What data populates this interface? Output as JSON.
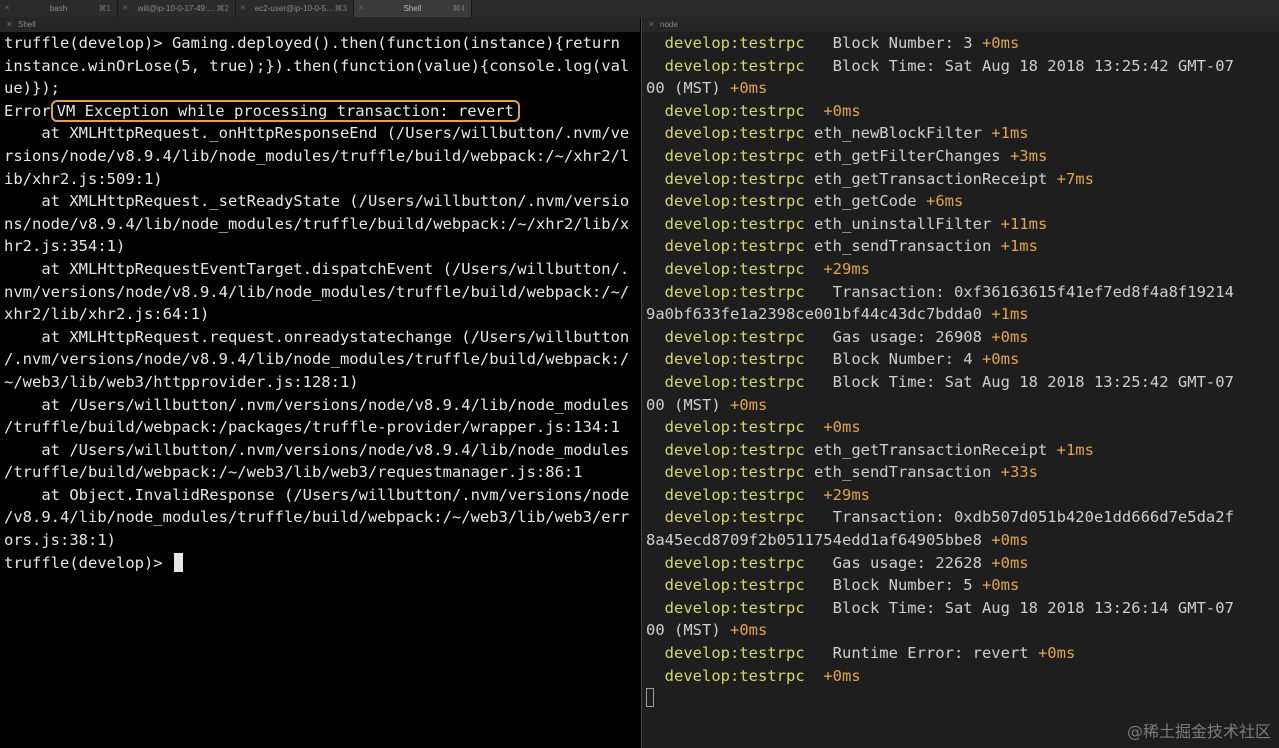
{
  "tabs": [
    {
      "title": "bash",
      "shortcut": "⌘1"
    },
    {
      "title": "will@ip-10-0-17-49:…",
      "shortcut": "⌘2"
    },
    {
      "title": "ec2-user@ip-10-0-5…",
      "shortcut": "⌘3"
    },
    {
      "title": "Shell",
      "shortcut": "⌘4"
    }
  ],
  "left_pane": {
    "title": "Shell",
    "lines": [
      "truffle(develop)> Gaming.deployed().then(function(instance){return",
      "instance.winOrLose(5, true);}).then(function(value){console.log(val",
      "ue)});",
      "",
      "    at XMLHttpRequest._onHttpResponseEnd (/Users/willbutton/.nvm/ve",
      "rsions/node/v8.9.4/lib/node_modules/truffle/build/webpack:/~/xhr2/l",
      "ib/xhr2.js:509:1)",
      "    at XMLHttpRequest._setReadyState (/Users/willbutton/.nvm/versio",
      "ns/node/v8.9.4/lib/node_modules/truffle/build/webpack:/~/xhr2/lib/x",
      "hr2.js:354:1)",
      "    at XMLHttpRequestEventTarget.dispatchEvent (/Users/willbutton/.",
      "nvm/versions/node/v8.9.4/lib/node_modules/truffle/build/webpack:/~/",
      "xhr2/lib/xhr2.js:64:1)",
      "    at XMLHttpRequest.request.onreadystatechange (/Users/willbutton",
      "/.nvm/versions/node/v8.9.4/lib/node_modules/truffle/build/webpack:/",
      "~/web3/lib/web3/httpprovider.js:128:1)",
      "    at /Users/willbutton/.nvm/versions/node/v8.9.4/lib/node_modules",
      "/truffle/build/webpack:/packages/truffle-provider/wrapper.js:134:1",
      "    at /Users/willbutton/.nvm/versions/node/v8.9.4/lib/node_modules",
      "/truffle/build/webpack:/~/web3/lib/web3/requestmanager.js:86:1",
      "    at Object.InvalidResponse (/Users/willbutton/.nvm/versions/node",
      "/v8.9.4/lib/node_modules/truffle/build/webpack:/~/web3/lib/web3/err",
      "ors.js:38:1)"
    ],
    "error_prefix": "Error",
    "error_message": "VM Exception while processing transaction: revert",
    "prompt": "truffle(develop)> "
  },
  "right_pane": {
    "title": "node",
    "lines": [
      {
        "g": "develop:testrpc",
        "m": "   Block Number: 3 ",
        "t": "+0ms"
      },
      {
        "g": "develop:testrpc",
        "m": "   Block Time: Sat Aug 18 2018 13:25:42 GMT-07",
        "t": ""
      },
      {
        "g": "",
        "m": "00 (MST) ",
        "t": "+0ms",
        "wrap": true
      },
      {
        "g": "develop:testrpc",
        "m": "  ",
        "t": "+0ms"
      },
      {
        "g": "develop:testrpc",
        "m": " eth_newBlockFilter ",
        "t": "+1ms"
      },
      {
        "g": "develop:testrpc",
        "m": " eth_getFilterChanges ",
        "t": "+3ms"
      },
      {
        "g": "develop:testrpc",
        "m": " eth_getTransactionReceipt ",
        "t": "+7ms"
      },
      {
        "g": "develop:testrpc",
        "m": " eth_getCode ",
        "t": "+6ms"
      },
      {
        "g": "develop:testrpc",
        "m": " eth_uninstallFilter ",
        "t": "+11ms"
      },
      {
        "g": "develop:testrpc",
        "m": " eth_sendTransaction ",
        "t": "+1ms"
      },
      {
        "g": "develop:testrpc",
        "m": "  ",
        "t": "+29ms"
      },
      {
        "g": "develop:testrpc",
        "m": "   Transaction: 0xf36163615f41ef7ed8f4a8f19214",
        "t": ""
      },
      {
        "g": "",
        "m": "9a0bf633fe1a2398ce001bf44c43dc7bdda0 ",
        "t": "+1ms",
        "wrap": true
      },
      {
        "g": "develop:testrpc",
        "m": "   Gas usage: 26908 ",
        "t": "+0ms"
      },
      {
        "g": "develop:testrpc",
        "m": "   Block Number: 4 ",
        "t": "+0ms"
      },
      {
        "g": "develop:testrpc",
        "m": "   Block Time: Sat Aug 18 2018 13:25:42 GMT-07",
        "t": ""
      },
      {
        "g": "",
        "m": "00 (MST) ",
        "t": "+0ms",
        "wrap": true
      },
      {
        "g": "develop:testrpc",
        "m": "  ",
        "t": "+0ms"
      },
      {
        "g": "develop:testrpc",
        "m": " eth_getTransactionReceipt ",
        "t": "+1ms"
      },
      {
        "g": "develop:testrpc",
        "m": " eth_sendTransaction ",
        "t": "+33s"
      },
      {
        "g": "develop:testrpc",
        "m": "  ",
        "t": "+29ms"
      },
      {
        "g": "develop:testrpc",
        "m": "   Transaction: 0xdb507d051b420e1dd666d7e5da2f",
        "t": ""
      },
      {
        "g": "",
        "m": "8a45ecd8709f2b0511754edd1af64905bbe8 ",
        "t": "+0ms",
        "wrap": true
      },
      {
        "g": "develop:testrpc",
        "m": "   Gas usage: 22628 ",
        "t": "+0ms"
      },
      {
        "g": "develop:testrpc",
        "m": "   Block Number: 5 ",
        "t": "+0ms"
      },
      {
        "g": "develop:testrpc",
        "m": "   Block Time: Sat Aug 18 2018 13:26:14 GMT-07",
        "t": ""
      },
      {
        "g": "",
        "m": "00 (MST) ",
        "t": "+0ms",
        "wrap": true
      },
      {
        "g": "develop:testrpc",
        "m": "   Runtime Error: revert ",
        "t": "+0ms"
      },
      {
        "g": "develop:testrpc",
        "m": "  ",
        "t": "+0ms"
      }
    ]
  },
  "watermark": "@稀土掘金技术社区",
  "colors": {
    "namespace": "#d6d66e",
    "timing": "#e2a54c",
    "highlight_border": "#e3a24a"
  }
}
